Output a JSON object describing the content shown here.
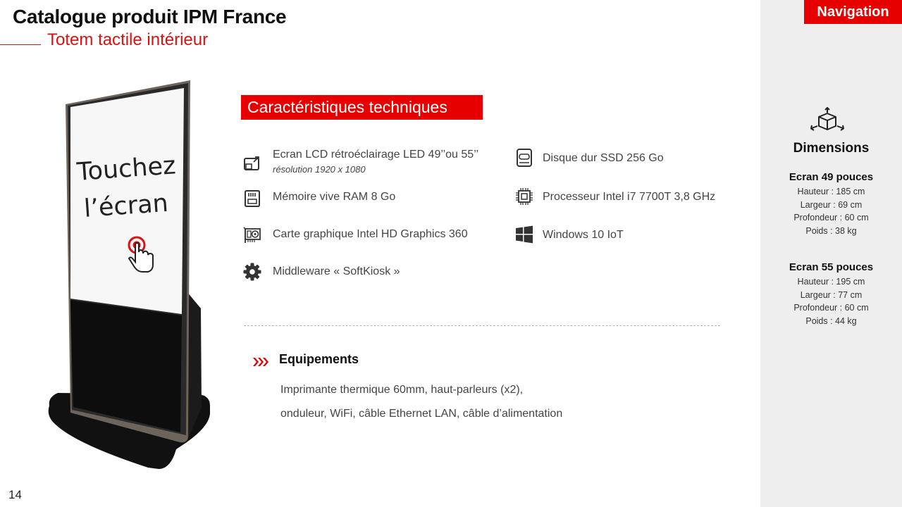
{
  "header": {
    "title": "Catalogue produit IPM France",
    "subtitle": "Totem tactile intérieur"
  },
  "page_number": "14",
  "kiosk": {
    "screen_text_line1": "Touchez",
    "screen_text_line2": "l’écran"
  },
  "specs": {
    "heading": "Caractéristiques techniques",
    "items": [
      {
        "icon": "screen-resize-icon",
        "label": "Ecran LCD rétroéclairage LED 49’’ou 55’’",
        "sub": "résolution 1920 x 1080"
      },
      {
        "icon": "hard-drive-icon",
        "label": "Disque dur SSD 256 Go"
      },
      {
        "icon": "sd-card-icon",
        "label": "Mémoire vive RAM 8 Go"
      },
      {
        "icon": "cpu-chip-icon",
        "label": "Processeur Intel i7 7700T 3,8 GHz"
      },
      {
        "icon": "graphics-card-icon",
        "label": "Carte graphique Intel HD Graphics 360"
      },
      {
        "icon": "windows-logo-icon",
        "label": "Windows 10 IoT"
      },
      {
        "icon": "gear-icon",
        "label": "Middleware « SoftKiosk »"
      }
    ]
  },
  "equipment": {
    "title": "Equipements",
    "line1": "Imprimante thermique 60mm, haut-parleurs (x2),",
    "line2": "onduleur, WiFi, câble Ethernet LAN, câble d’alimentation"
  },
  "sidebar": {
    "nav_label": "Navigation",
    "dimensions_title": "Dimensions",
    "screens": [
      {
        "name": "Ecran 49 pouces",
        "lines": [
          "Hauteur : 185 cm",
          "Largeur : 69 cm",
          "Profondeur : 60 cm",
          "Poids : 38 kg"
        ]
      },
      {
        "name": "Ecran 55 pouces",
        "lines": [
          "Hauteur : 195 cm",
          "Largeur : 77 cm",
          "Profondeur : 60 cm",
          "Poids : 44 kg"
        ]
      }
    ]
  },
  "colors": {
    "accent_red": "#e60000",
    "sidebar_bg": "#eeeeee"
  }
}
